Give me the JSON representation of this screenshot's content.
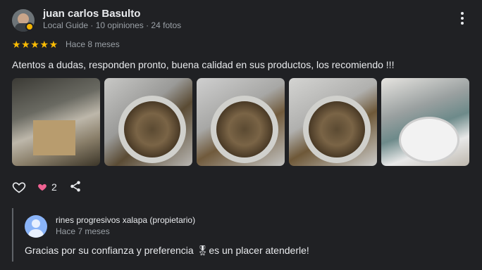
{
  "reviewer": {
    "name": "juan carlos Basulto",
    "meta": "Local Guide · 10 opiniones · 24 fotos"
  },
  "rating": {
    "stars": "★★★★★",
    "value": 5,
    "time_ago": "Hace 8 meses"
  },
  "review_text": "Atentos a dudas, responden pronto, buena calidad en sus productos, los recomiendo !!!",
  "photos": [
    "photo-1",
    "photo-2",
    "photo-3",
    "photo-4",
    "photo-5"
  ],
  "actions": {
    "like_count": "2"
  },
  "owner_reply": {
    "name": "rines progresivos xalapa (propietario)",
    "time_ago": "Hace 7 meses",
    "text": "Gracias por su confianza y preferencia 🎖es un placer atenderle!"
  },
  "colors": {
    "background": "#202124",
    "star": "#fbbc04",
    "heart": "#f06292",
    "owner_avatar": "#8ab4f8"
  }
}
